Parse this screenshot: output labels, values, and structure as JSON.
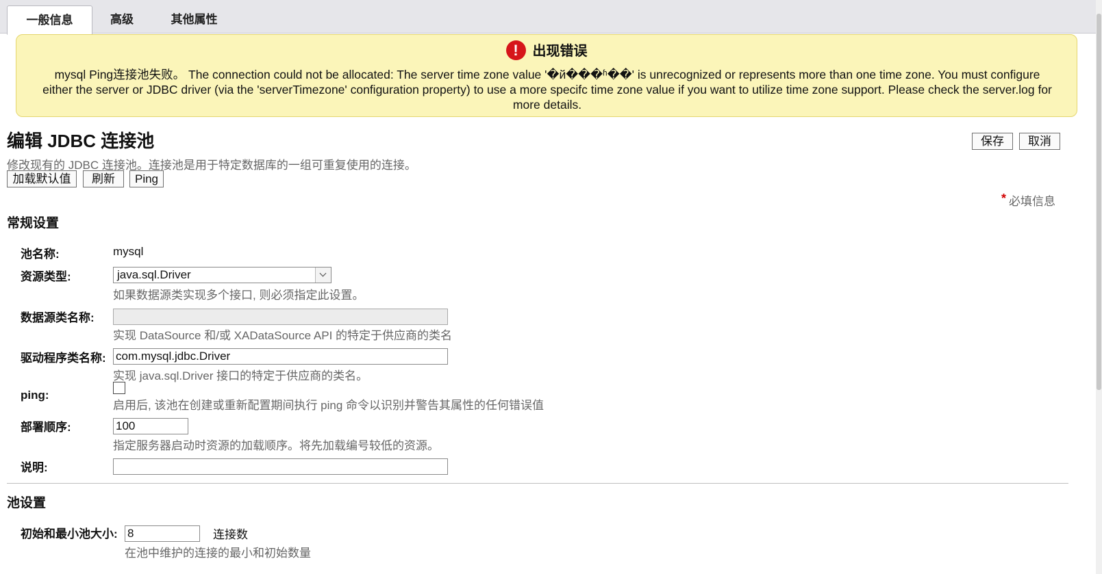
{
  "tabs": [
    {
      "label": "一般信息",
      "active": true
    },
    {
      "label": "高级",
      "active": false
    },
    {
      "label": "其他属性",
      "active": false
    }
  ],
  "error": {
    "title": "出现错误",
    "icon": "error-icon",
    "message": "mysql Ping连接池失败。 The connection could not be allocated: The server time zone value '�й���ʱ��' is unrecognized or represents more than one time zone. You must configure either the server or JDBC driver (via the 'serverTimezone' configuration property) to use a more specifc time zone value if you want to utilize time zone support. Please check the server.log for more details."
  },
  "header": {
    "title": "编辑 JDBC 连接池",
    "description": "修改现有的 JDBC 连接池。连接池是用于特定数据库的一组可重复使用的连接。",
    "save_label": "保存",
    "cancel_label": "取消",
    "load_defaults_label": "加载默认值",
    "refresh_label": "刷新",
    "ping_label": "Ping",
    "required_note": "必填信息",
    "required_star": "*"
  },
  "general": {
    "section_title": "常规设置",
    "pool_name_label": "池名称:",
    "pool_name_value": "mysql",
    "resource_type_label": "资源类型:",
    "resource_type_value": "java.sql.Driver",
    "resource_type_help": "如果数据源类实现多个接口, 则必须指定此设置。",
    "datasource_class_label": "数据源类名称:",
    "datasource_class_value": "",
    "datasource_class_help": "实现 DataSource 和/或 XADataSource API 的特定于供应商的类名",
    "driver_class_label": "驱动程序类名称:",
    "driver_class_value": "com.mysql.jdbc.Driver",
    "driver_class_help": "实现 java.sql.Driver 接口的特定于供应商的类名。",
    "ping_label": "ping:",
    "ping_checked": false,
    "ping_help": "启用后, 该池在创建或重新配置期间执行 ping 命令以识别并警告其属性的任何错误值",
    "deploy_order_label": "部署顺序:",
    "deploy_order_value": "100",
    "deploy_order_help": "指定服务器启动时资源的加载顺序。将先加载编号较低的资源。",
    "description_label": "说明:",
    "description_value": ""
  },
  "pool": {
    "section_title": "池设置",
    "min_size_label": "初始和最小池大小:",
    "min_size_value": "8",
    "min_size_unit": "连接数",
    "min_size_help": "在池中维护的连接的最小和初始数量"
  }
}
